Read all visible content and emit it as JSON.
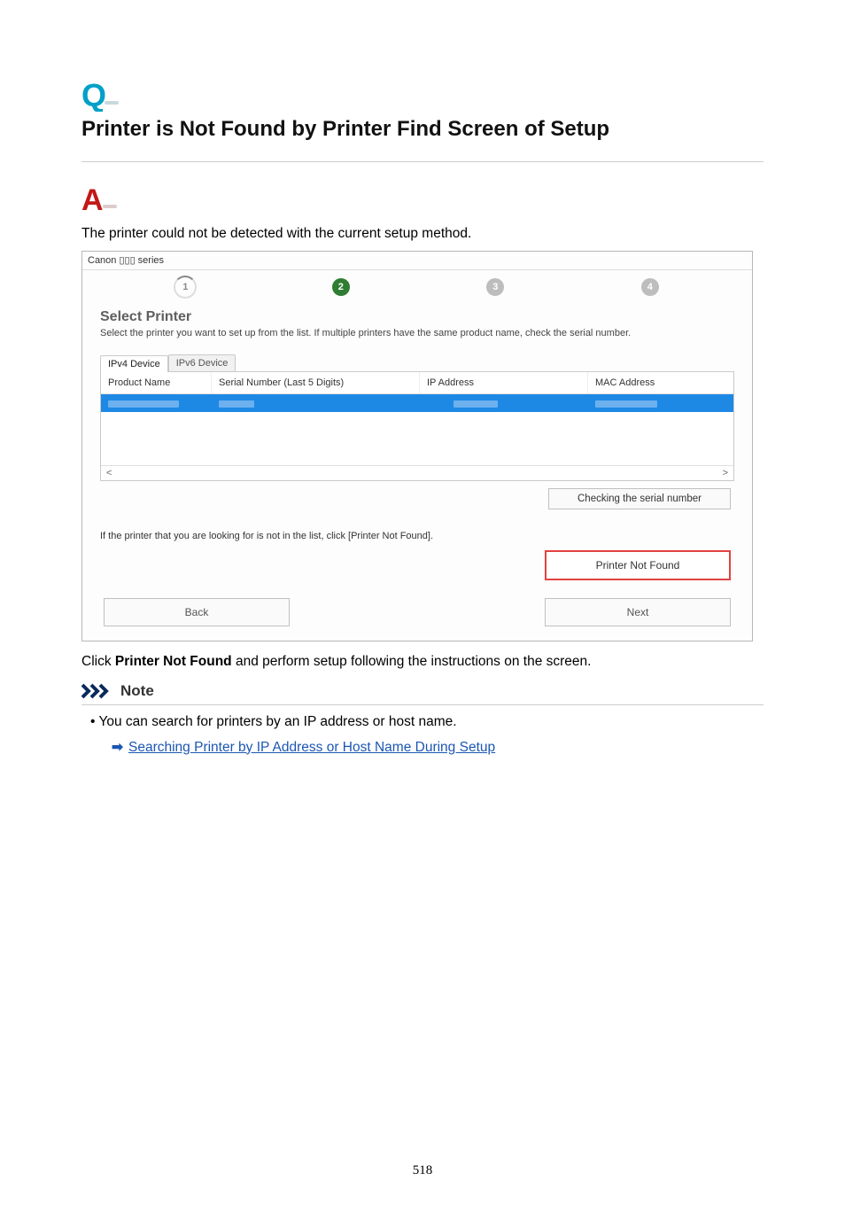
{
  "page_number": "518",
  "heading": "Printer is Not Found by Printer Find Screen of Setup",
  "intro": "The printer could not be detected with the current setup method.",
  "screenshot": {
    "window_title": "Canon ▯▯▯ series",
    "steps": [
      "1",
      "2",
      "3",
      "4"
    ],
    "section_title": "Select Printer",
    "section_subtitle": "Select the printer you want to set up from the list. If multiple printers have the same product name, check the serial number.",
    "tabs": {
      "active": "IPv4 Device",
      "inactive": "IPv6 Device"
    },
    "columns": {
      "product_name": "Product Name",
      "serial": "Serial Number (Last 5 Digits)",
      "ip": "IP Address",
      "mac": "MAC Address"
    },
    "scroll_left": "<",
    "scroll_right": ">",
    "serial_button": "Checking the serial number",
    "hint": "If the printer that you are looking for is not in the list, click [Printer Not Found].",
    "printer_not_found": "Printer Not Found",
    "back": "Back",
    "next": "Next"
  },
  "post": {
    "prefix": "Click ",
    "bold": "Printer Not Found",
    "suffix": " and perform setup following the instructions on the screen."
  },
  "note": {
    "label": "Note",
    "bullet": "You can search for printers by an IP address or host name.",
    "link": "Searching Printer by IP Address or Host Name During Setup"
  }
}
